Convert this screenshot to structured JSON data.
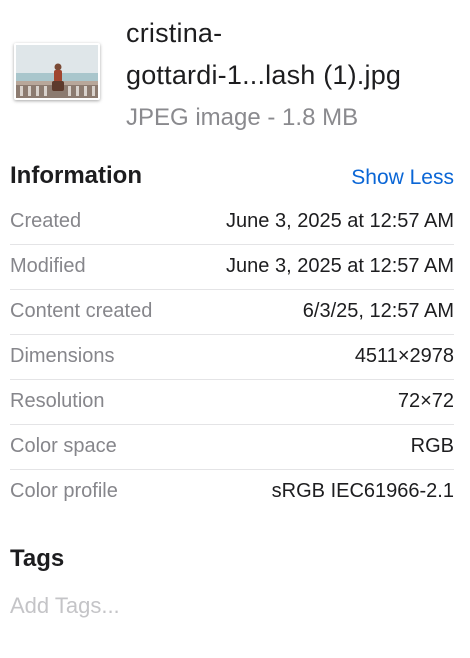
{
  "file": {
    "name_line1": "cristina-",
    "name_line2": "gottardi-1...lash (1).jpg",
    "kind_size": "JPEG image - 1.8 MB",
    "thumbnail_icon": "photo-thumbnail"
  },
  "information": {
    "title": "Information",
    "toggle_label": "Show Less",
    "rows": [
      {
        "label": "Created",
        "value": "June 3, 2025 at 12:57 AM"
      },
      {
        "label": "Modified",
        "value": "June 3, 2025 at 12:57 AM"
      },
      {
        "label": "Content created",
        "value": "6/3/25, 12:57 AM"
      },
      {
        "label": "Dimensions",
        "value": "4511×2978"
      },
      {
        "label": "Resolution",
        "value": "72×72"
      },
      {
        "label": "Color space",
        "value": "RGB"
      },
      {
        "label": "Color profile",
        "value": "sRGB IEC61966-2.1"
      }
    ]
  },
  "tags": {
    "title": "Tags",
    "placeholder": "Add Tags..."
  },
  "colors": {
    "accent": "#0a66d6",
    "label_gray": "#86868b",
    "text": "#1d1d1f"
  }
}
